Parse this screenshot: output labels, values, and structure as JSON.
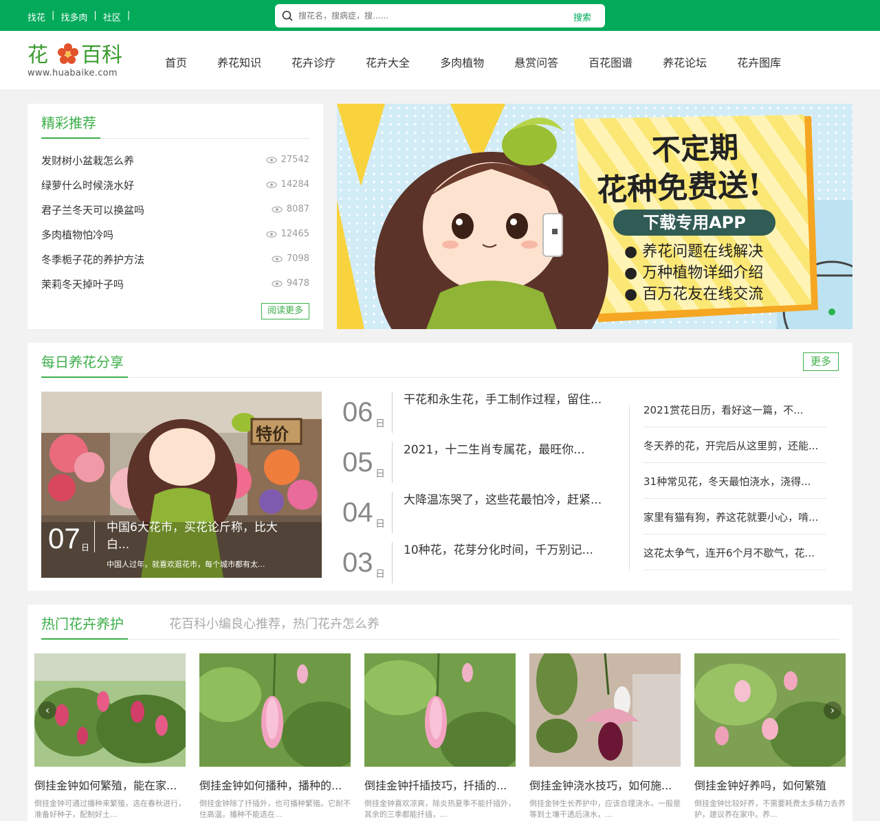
{
  "colors": {
    "brand": "#02aa5a",
    "accent": "#3bae48",
    "text": "#333333",
    "muted": "#999999"
  },
  "top": {
    "links": [
      "找花",
      "找多肉",
      "社区"
    ],
    "separator": "|",
    "search_placeholder": "搜花名，搜病症，搜......",
    "search_button": "搜索"
  },
  "logo": {
    "name": "花百科",
    "char1": "花",
    "char2": "百科",
    "url": "www.huabaike.com"
  },
  "nav": [
    "首页",
    "养花知识",
    "花卉诊疗",
    "花卉大全",
    "多肉植物",
    "悬赏问答",
    "百花图谱",
    "养花论坛",
    "花卉图库"
  ],
  "recommend": {
    "title": "精彩推荐",
    "items": [
      {
        "title": "发财树小盆栽怎么养",
        "views": "27542"
      },
      {
        "title": "绿萝什么时候浇水好",
        "views": "14284"
      },
      {
        "title": "君子兰冬天可以换盆吗",
        "views": "8087"
      },
      {
        "title": "多肉植物怕冷吗",
        "views": "12465"
      },
      {
        "title": "冬季栀子花的养护方法",
        "views": "7098"
      },
      {
        "title": "茉莉冬天掉叶子吗",
        "views": "9478"
      }
    ],
    "more": "阅读更多"
  },
  "banner": {
    "line1": "不定期",
    "line2": "花种免费送!",
    "button": "下载专用APP",
    "bullets": [
      "养花问题在线解决",
      "万种植物详细介绍",
      "百万花友在线交流"
    ]
  },
  "daily": {
    "title": "每日养花分享",
    "more": "更多",
    "feature": {
      "day": "07",
      "day_unit": "日",
      "title": "中国6大花市，买花论斤称，比大白...",
      "desc": "中国人过年，就喜欢逛花市，每个城市都有太...",
      "sign": "特价"
    },
    "dated": [
      {
        "num": "06",
        "unit": "日",
        "title": "干花和永生花，手工制作过程，留住..."
      },
      {
        "num": "05",
        "unit": "日",
        "title": "2021，十二生肖专属花，最旺你..."
      },
      {
        "num": "04",
        "unit": "日",
        "title": "大降温冻哭了，这些花最怕冷，赶紧..."
      },
      {
        "num": "03",
        "unit": "日",
        "title": "10种花，花芽分化时间，千万别记..."
      }
    ],
    "right_list": [
      "2021赏花日历，看好这一篇，不...",
      "冬天养的花，开完后从这里剪，还能...",
      "31种常见花，冬天最怕浇水，浇得...",
      "家里有猫有狗，养这花就要小心，啃...",
      "这花太争气，连开6个月不歇气，花..."
    ]
  },
  "hot": {
    "title": "热门花卉养护",
    "subtitle": "花百科小编良心推荐，热门花卉怎么养",
    "prev": "‹",
    "next": "›",
    "cards": [
      {
        "title": "倒挂金钟如何繁殖，能在家...",
        "desc": "倒挂金钟可通过播种来繁殖，选在春秋进行，准备好种子，配制好土..."
      },
      {
        "title": "倒挂金钟如何播种，播种的...",
        "desc": "倒挂金钟除了扦插外，也可播种繁殖。它耐不住高温，播种不能选在..."
      },
      {
        "title": "倒挂金钟扦插技巧，扦插的...",
        "desc": "倒挂金钟喜欢凉爽，除炎热夏季不能扦插外，其余的三季都能扦插，..."
      },
      {
        "title": "倒挂金钟浇水技巧，如何施...",
        "desc": "倒挂金钟生长养护中，应该合理浇水，一般是等到土壤干透后浇水，..."
      },
      {
        "title": "倒挂金钟好养吗，如何繁殖",
        "desc": "倒挂金钟比较好养，不需要耗费太多精力去养护，建议养在家中。养..."
      }
    ]
  }
}
